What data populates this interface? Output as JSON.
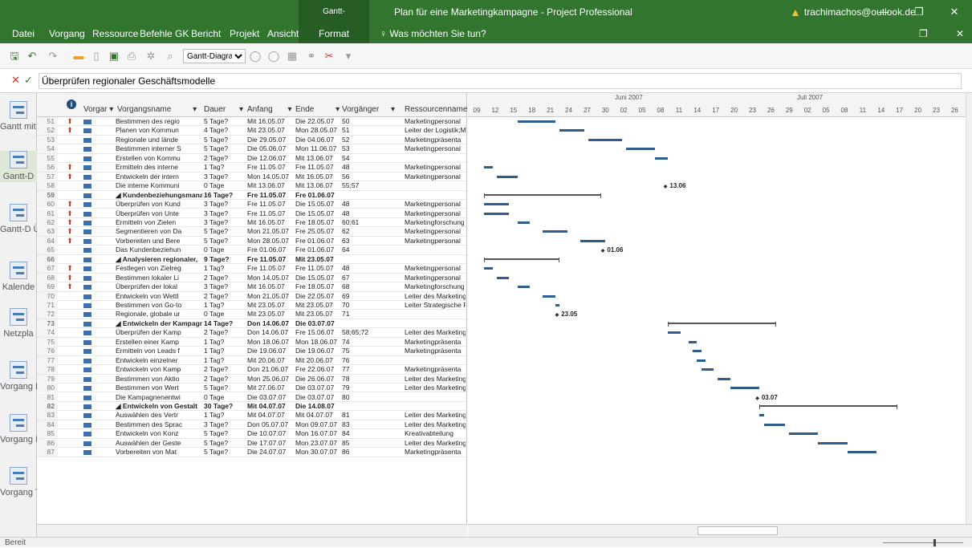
{
  "titlebar": {
    "context_tab": "Gantt-Diagrammtools",
    "title": "Plan für eine Marketingkampagne - Project Professional",
    "user": "trachimachos@outlook.de",
    "minimize": "—",
    "restore": "❐",
    "close": "✕"
  },
  "menu": {
    "file": "Datei",
    "task": "Vorgang",
    "resource": "Ressource",
    "commands": "Befehle GK",
    "report": "Bericht",
    "project": "Projekt",
    "view": "Ansicht",
    "format": "Format",
    "tellme": "Was möchten Sie tun?",
    "restore": "❐",
    "close": "✕"
  },
  "qat": {
    "view_select": "Gantt-Diagram▾"
  },
  "entry": {
    "cancel": "✕",
    "ok": "✓",
    "value": "Überprüfen regionaler Geschäftsmodelle"
  },
  "viewbar": [
    {
      "label": "Gantt mit ..."
    },
    {
      "label": "Gantt-D"
    },
    {
      "label": "Gantt-D Überwa"
    },
    {
      "label": "Kalende"
    },
    {
      "label": "Netzpla"
    },
    {
      "label": "Vorgang Einsatz"
    },
    {
      "label": "Vorgang Maske"
    },
    {
      "label": "Vorgang Tabelle"
    }
  ],
  "columns": {
    "mode": "Vorgar ▾",
    "name": "Vorgangsname",
    "duration": "Dauer",
    "start": "Anfang",
    "finish": "Ende",
    "predecessors": "Vorgänger",
    "resources": "Ressourcenname ▾",
    "info": "i"
  },
  "timeline": {
    "months": [
      {
        "label": "Juni 2007"
      },
      {
        "label": "Juli 2007"
      }
    ],
    "days": [
      "09",
      "12",
      "15",
      "18",
      "21",
      "24",
      "27",
      "30",
      "02",
      "05",
      "08",
      "11",
      "14",
      "17",
      "20",
      "23",
      "26",
      "29",
      "02",
      "05",
      "08",
      "11",
      "14",
      "17",
      "20",
      "23",
      "26"
    ]
  },
  "rows": [
    {
      "id": "51",
      "ind": "⬆",
      "name": "Bestimmen des regio",
      "dur": "5 Tage?",
      "start": "Mit 16.05.07",
      "end": "Die 22.05.07",
      "pred": "50",
      "res": "Marketingpersonal",
      "s": "",
      "bar": [
        9,
        18
      ]
    },
    {
      "id": "52",
      "ind": "⬆",
      "name": "Planen von Kommun",
      "dur": "4 Tage?",
      "start": "Mit 23.05.07",
      "end": "Mon 28.05.07",
      "pred": "51",
      "res": "Leiter der Logistik;Ma",
      "s": "",
      "bar": [
        19,
        25
      ]
    },
    {
      "id": "53",
      "ind": "",
      "name": "Regionale und lände",
      "dur": "5 Tage?",
      "start": "Die 29.05.07",
      "end": "Die 04.06.07",
      "pred": "52",
      "res": "Marketingpräsenta",
      "s": "",
      "bar": [
        26,
        34
      ]
    },
    {
      "id": "54",
      "ind": "",
      "name": "Bestimmen interner S",
      "dur": "5 Tage?",
      "start": "Die 05.06.07",
      "end": "Mon 11.06.07",
      "pred": "53",
      "res": "Marketingpersonal",
      "s": "",
      "bar": [
        35,
        42
      ]
    },
    {
      "id": "55",
      "ind": "",
      "name": "Erstellen von Kommu",
      "dur": "2 Tage?",
      "start": "Die 12.06.07",
      "end": "Mit 13.06.07",
      "pred": "54",
      "res": "",
      "s": "",
      "bar": [
        42,
        45
      ]
    },
    {
      "id": "56",
      "ind": "⬆",
      "name": "Ermitteln des interne",
      "dur": "1 Tag?",
      "start": "Fre 11.05.07",
      "end": "Fre 11.05.07",
      "pred": "48",
      "res": "Marketingpersonal",
      "s": "",
      "bar": [
        1,
        3
      ]
    },
    {
      "id": "57",
      "ind": "⬆",
      "name": "Entwickeln der intern",
      "dur": "3 Tage?",
      "start": "Mon 14.05.07",
      "end": "Mit 16.05.07",
      "pred": "56",
      "res": "Marketingpersonal",
      "s": "",
      "bar": [
        4,
        9
      ]
    },
    {
      "id": "58",
      "ind": "",
      "name": "Die interne Kommuni",
      "dur": "0 Tage",
      "start": "Mit 13.06.07",
      "end": "Mit 13.06.07",
      "pred": "55;57",
      "res": "",
      "s": "m",
      "ms": [
        44,
        "13.06"
      ]
    },
    {
      "id": "59",
      "ind": "",
      "name": "◢ Kundenbeziehungsmana",
      "dur": "16 Tage?",
      "start": "Fre 11.05.07",
      "end": "Fre 01.06.07",
      "pred": "",
      "res": "",
      "s": "s",
      "bar": [
        1,
        29
      ]
    },
    {
      "id": "60",
      "ind": "⬆",
      "name": "Überprüfen von Kund",
      "dur": "3 Tage?",
      "start": "Fre 11.05.07",
      "end": "Die 15.05.07",
      "pred": "48",
      "res": "Marketingpersonal",
      "s": "",
      "bar": [
        1,
        7
      ]
    },
    {
      "id": "61",
      "ind": "⬆",
      "name": "Überprüfen von Unte",
      "dur": "3 Tage?",
      "start": "Fre 11.05.07",
      "end": "Die 15.05.07",
      "pred": "48",
      "res": "Marketingpersonal",
      "s": "",
      "bar": [
        1,
        7
      ]
    },
    {
      "id": "62",
      "ind": "⬆",
      "name": "Ermitteln von Zielen",
      "dur": "3 Tage?",
      "start": "Mit 16.05.07",
      "end": "Fre 18.05.07",
      "pred": "60;61",
      "res": "Marketingforschung",
      "s": "",
      "bar": [
        9,
        12
      ]
    },
    {
      "id": "63",
      "ind": "⬆",
      "name": "Segmentieren von Da",
      "dur": "5 Tage?",
      "start": "Mon 21.05.07",
      "end": "Fre 25.05.07",
      "pred": "62",
      "res": "Marketingpersonal",
      "s": "",
      "bar": [
        15,
        21
      ]
    },
    {
      "id": "64",
      "ind": "⬆",
      "name": "Vorbereiten und Bere",
      "dur": "5 Tage?",
      "start": "Mon 28.05.07",
      "end": "Fre 01.06.07",
      "pred": "63",
      "res": "Marketingpersonal",
      "s": "",
      "bar": [
        24,
        30
      ]
    },
    {
      "id": "65",
      "ind": "",
      "name": "Das Kundenbeziehun",
      "dur": "0 Tage",
      "start": "Fre 01.06.07",
      "end": "Fre 01.06.07",
      "pred": "64",
      "res": "",
      "s": "m",
      "ms": [
        29,
        "01.06"
      ]
    },
    {
      "id": "66",
      "ind": "",
      "name": "◢ Analysieren regionaler,",
      "dur": "9 Tage?",
      "start": "Fre 11.05.07",
      "end": "Mit 23.05.07",
      "pred": "",
      "res": "",
      "s": "s",
      "bar": [
        1,
        19
      ]
    },
    {
      "id": "67",
      "ind": "⬆",
      "name": "Festlegen von Zielreg",
      "dur": "1 Tag?",
      "start": "Fre 11.05.07",
      "end": "Fre 11.05.07",
      "pred": "48",
      "res": "Marketingpersonal",
      "s": "",
      "bar": [
        1,
        3
      ]
    },
    {
      "id": "68",
      "ind": "⬆",
      "name": "Bestimmen lokaler Li",
      "dur": "2 Tage?",
      "start": "Mon 14.05.07",
      "end": "Die 15.05.07",
      "pred": "67",
      "res": "Marketingpersonal",
      "s": "",
      "bar": [
        4,
        7
      ]
    },
    {
      "id": "69",
      "ind": "⬆",
      "name": "Überprüfen der lokal",
      "dur": "3 Tage?",
      "start": "Mit 16.05.07",
      "end": "Fre 18.05.07",
      "pred": "68",
      "res": "Marketingforschung",
      "s": "",
      "bar": [
        9,
        12
      ]
    },
    {
      "id": "70",
      "ind": "",
      "name": "Entwickeln von Wettl",
      "dur": "2 Tage?",
      "start": "Mon 21.05.07",
      "end": "Die 22.05.07",
      "pred": "69",
      "res": "Leiter des Marketing;l",
      "s": "",
      "bar": [
        15,
        18
      ]
    },
    {
      "id": "71",
      "ind": "",
      "name": "Bestimmen von Go-to",
      "dur": "1 Tag?",
      "start": "Mit 23.05.07",
      "end": "Mit 23.05.07",
      "pred": "70",
      "res": "Leiter Strategische Pa",
      "s": "",
      "bar": [
        18,
        19
      ]
    },
    {
      "id": "72",
      "ind": "",
      "name": "Regionale, globale ur",
      "dur": "0 Tage",
      "start": "Mit 23.05.07",
      "end": "Mit 23.05.07",
      "pred": "71",
      "res": "",
      "s": "m",
      "ms": [
        18,
        "23.05"
      ]
    },
    {
      "id": "73",
      "ind": "",
      "name": "◢ Entwickeln der Kampagn",
      "dur": "14 Tage?",
      "start": "Don 14.06.07",
      "end": "Die 03.07.07",
      "pred": "",
      "res": "",
      "s": "s",
      "bar": [
        45,
        71
      ]
    },
    {
      "id": "74",
      "ind": "",
      "name": "Überprüfen der Kamp",
      "dur": "2 Tage?",
      "start": "Don 14.06.07",
      "end": "Fre 15.06.07",
      "pred": "58;65;72",
      "res": "Leiter des Marketing",
      "s": "",
      "bar": [
        45,
        48
      ]
    },
    {
      "id": "75",
      "ind": "",
      "name": "Erstellen einer Kamp",
      "dur": "1 Tag?",
      "start": "Mon 18.06.07",
      "end": "Mon 18.06.07",
      "pred": "74",
      "res": "Marketingpräsenta",
      "s": "",
      "bar": [
        50,
        52
      ]
    },
    {
      "id": "76",
      "ind": "",
      "name": "Ermitteln von Leads f",
      "dur": "1 Tag?",
      "start": "Die 19.06.07",
      "end": "Die 19.06.07",
      "pred": "75",
      "res": "Marketingpräsenta",
      "s": "",
      "bar": [
        51,
        53
      ]
    },
    {
      "id": "77",
      "ind": "",
      "name": "Entwickeln einzelner",
      "dur": "1 Tag?",
      "start": "Mit 20.06.07",
      "end": "Mit 20.06.07",
      "pred": "76",
      "res": "",
      "s": "",
      "bar": [
        52,
        54
      ]
    },
    {
      "id": "78",
      "ind": "",
      "name": "Entwickeln von Kamp",
      "dur": "2 Tage?",
      "start": "Don 21.06.07",
      "end": "Fre 22.06.07",
      "pred": "77",
      "res": "Marketingpräsenta",
      "s": "",
      "bar": [
        53,
        56
      ]
    },
    {
      "id": "79",
      "ind": "",
      "name": "Bestimmen von Aktio",
      "dur": "2 Tage?",
      "start": "Mon 25.06.07",
      "end": "Die 26.06.07",
      "pred": "78",
      "res": "Leiter des Marketing",
      "s": "",
      "bar": [
        57,
        60
      ]
    },
    {
      "id": "80",
      "ind": "",
      "name": "Bestimmen von Wert",
      "dur": "5 Tage?",
      "start": "Mit 27.06.07",
      "end": "Die 03.07.07",
      "pred": "79",
      "res": "Leiter des Marketing",
      "s": "",
      "bar": [
        60,
        67
      ]
    },
    {
      "id": "81",
      "ind": "",
      "name": "Die Kampagnenentwi",
      "dur": "0 Tage",
      "start": "Die 03.07.07",
      "end": "Die 03.07.07",
      "pred": "80",
      "res": "",
      "s": "m",
      "ms": [
        66,
        "03.07"
      ]
    },
    {
      "id": "82",
      "ind": "",
      "name": "◢ Entwickeln von Gestalt",
      "dur": "30 Tage?",
      "start": "Mit 04.07.07",
      "end": "Die 14.08.07",
      "pred": "",
      "res": "",
      "s": "s",
      "bar": [
        67,
        100
      ]
    },
    {
      "id": "83",
      "ind": "",
      "name": "Auswählen des Vertr",
      "dur": "1 Tag?",
      "start": "Mit 04.07.07",
      "end": "Mit 04.07.07",
      "pred": "81",
      "res": "Leiter des Marketing;l",
      "s": "",
      "bar": [
        67,
        68
      ]
    },
    {
      "id": "84",
      "ind": "",
      "name": "Bestimmen des Sprac",
      "dur": "3 Tage?",
      "start": "Don 05.07.07",
      "end": "Mon 09.07.07",
      "pred": "83",
      "res": "Leiter des Marketing;l",
      "s": "",
      "bar": [
        68,
        73
      ]
    },
    {
      "id": "85",
      "ind": "",
      "name": "Entwickeln von Konz",
      "dur": "5 Tage?",
      "start": "Die 10.07.07",
      "end": "Mon 16.07.07",
      "pred": "84",
      "res": "Kreativabteilung",
      "s": "",
      "bar": [
        74,
        81
      ]
    },
    {
      "id": "86",
      "ind": "",
      "name": "Auswählen der Geste",
      "dur": "5 Tage?",
      "start": "Die 17.07.07",
      "end": "Mon 23.07.07",
      "pred": "85",
      "res": "Leiter des Marketing;l",
      "s": "",
      "bar": [
        81,
        88
      ]
    },
    {
      "id": "87",
      "ind": "",
      "name": "Vorbereiten von Mat",
      "dur": "5 Tage?",
      "start": "Die 24.07.07",
      "end": "Mon 30.07.07",
      "pred": "86",
      "res": "Marketingpräsenta",
      "s": "",
      "bar": [
        88,
        95
      ]
    }
  ],
  "status": {
    "text": "Bereit"
  }
}
